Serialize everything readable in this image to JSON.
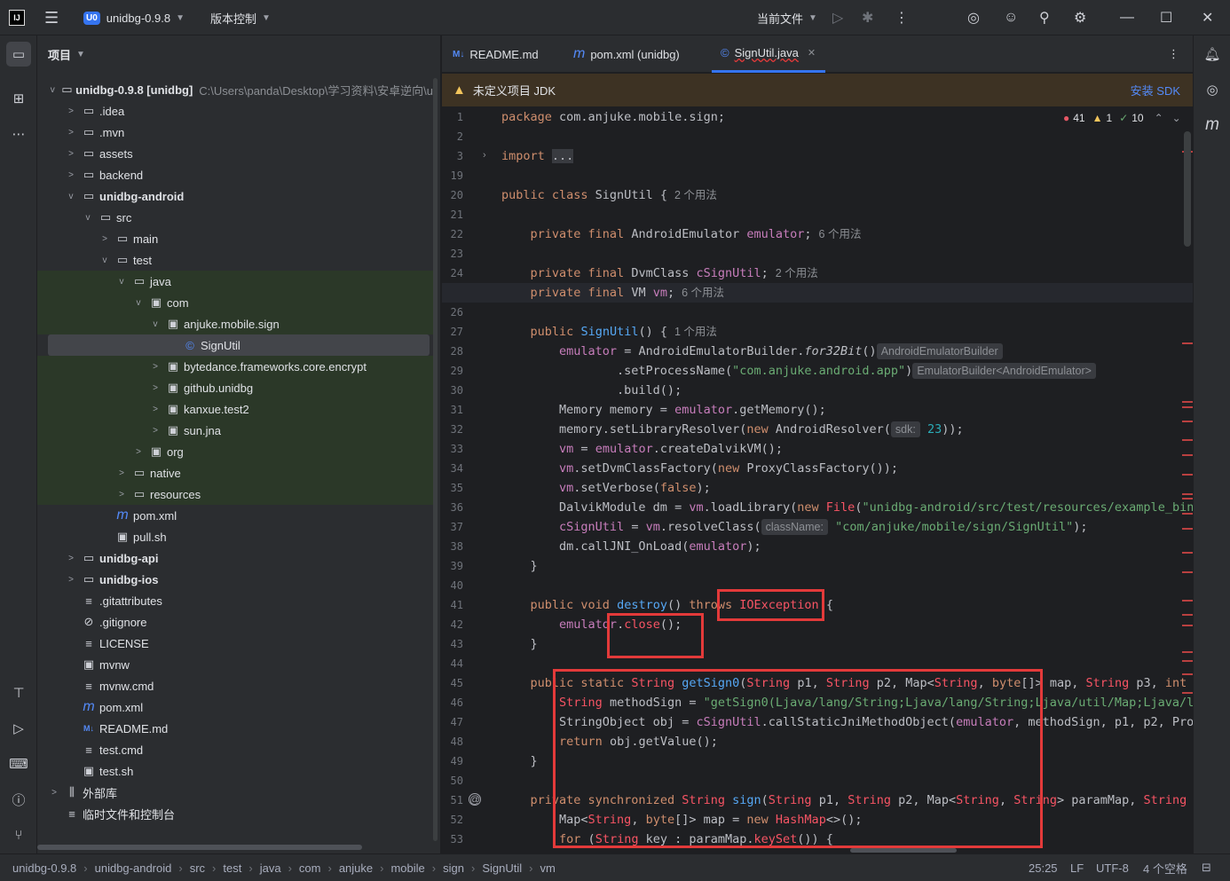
{
  "titlebar": {
    "logo": "IJ",
    "project_badge": "U0",
    "project": "unidbg-0.9.8",
    "vcs": "版本控制",
    "run_config": "当前文件"
  },
  "sidebar": {
    "panel_title": "项目"
  },
  "tree": [
    {
      "label": "unidbg-0.9.8 [unidbg]",
      "hint": "C:\\Users\\panda\\Desktop\\学习资料\\安卓逆向\\u",
      "indent": 0,
      "chev": "v",
      "icon": "▭",
      "bold": true
    },
    {
      "label": ".idea",
      "indent": 1,
      "chev": ">",
      "icon": "▭"
    },
    {
      "label": ".mvn",
      "indent": 1,
      "chev": ">",
      "icon": "▭"
    },
    {
      "label": "assets",
      "indent": 1,
      "chev": ">",
      "icon": "▭"
    },
    {
      "label": "backend",
      "indent": 1,
      "chev": ">",
      "icon": "▭"
    },
    {
      "label": "unidbg-android",
      "indent": 1,
      "chev": "v",
      "icon": "▭",
      "bold": true
    },
    {
      "label": "src",
      "indent": 2,
      "chev": "v",
      "icon": "▭"
    },
    {
      "label": "main",
      "indent": 3,
      "chev": ">",
      "icon": "▭"
    },
    {
      "label": "test",
      "indent": 3,
      "chev": "v",
      "icon": "▭"
    },
    {
      "label": "java",
      "indent": 4,
      "chev": "v",
      "icon": "▭",
      "green": true
    },
    {
      "label": "com",
      "indent": 5,
      "chev": "v",
      "icon": "▣",
      "green": true
    },
    {
      "label": "anjuke.mobile.sign",
      "indent": 6,
      "chev": "v",
      "icon": "▣",
      "green": true
    },
    {
      "label": "SignUtil",
      "indent": 7,
      "chev": "",
      "icon": "©",
      "sel": true
    },
    {
      "label": "bytedance.frameworks.core.encrypt",
      "indent": 6,
      "chev": ">",
      "icon": "▣",
      "green": true
    },
    {
      "label": "github.unidbg",
      "indent": 6,
      "chev": ">",
      "icon": "▣",
      "green": true
    },
    {
      "label": "kanxue.test2",
      "indent": 6,
      "chev": ">",
      "icon": "▣",
      "green": true
    },
    {
      "label": "sun.jna",
      "indent": 6,
      "chev": ">",
      "icon": "▣",
      "green": true
    },
    {
      "label": "org",
      "indent": 5,
      "chev": ">",
      "icon": "▣",
      "green": true
    },
    {
      "label": "native",
      "indent": 4,
      "chev": ">",
      "icon": "▭",
      "green": true
    },
    {
      "label": "resources",
      "indent": 4,
      "chev": ">",
      "icon": "▭",
      "green": true
    },
    {
      "label": "pom.xml",
      "indent": 3,
      "chev": "",
      "icon": "m"
    },
    {
      "label": "pull.sh",
      "indent": 3,
      "chev": "",
      "icon": "▣"
    },
    {
      "label": "unidbg-api",
      "indent": 1,
      "chev": ">",
      "icon": "▭",
      "bold": true
    },
    {
      "label": "unidbg-ios",
      "indent": 1,
      "chev": ">",
      "icon": "▭",
      "bold": true
    },
    {
      "label": ".gitattributes",
      "indent": 1,
      "chev": "",
      "icon": "≡"
    },
    {
      "label": ".gitignore",
      "indent": 1,
      "chev": "",
      "icon": "⊘"
    },
    {
      "label": "LICENSE",
      "indent": 1,
      "chev": "",
      "icon": "≡"
    },
    {
      "label": "mvnw",
      "indent": 1,
      "chev": "",
      "icon": "▣"
    },
    {
      "label": "mvnw.cmd",
      "indent": 1,
      "chev": "",
      "icon": "≡"
    },
    {
      "label": "pom.xml",
      "indent": 1,
      "chev": "",
      "icon": "m"
    },
    {
      "label": "README.md",
      "indent": 1,
      "chev": "",
      "icon": "M↓"
    },
    {
      "label": "test.cmd",
      "indent": 1,
      "chev": "",
      "icon": "≡"
    },
    {
      "label": "test.sh",
      "indent": 1,
      "chev": "",
      "icon": "▣"
    },
    {
      "label": "外部库",
      "indent": 0,
      "chev": ">",
      "icon": "⫼"
    },
    {
      "label": "临时文件和控制台",
      "indent": 0,
      "chev": "",
      "icon": "≡"
    }
  ],
  "tabs": [
    {
      "icon": "M↓",
      "label": "README.md",
      "active": false
    },
    {
      "icon": "m",
      "label": "pom.xml (unidbg)",
      "active": false
    },
    {
      "icon": "©",
      "label": "SignUtil.java",
      "active": true
    }
  ],
  "warning": {
    "text": "未定义项目 JDK",
    "action": "安装 SDK"
  },
  "inspections": {
    "errors": "41",
    "warnings": "1",
    "weak": "10"
  },
  "line_numbers": [
    "1",
    "2",
    "3",
    "19",
    "20",
    "21",
    "22",
    "23",
    "24",
    "25",
    "26",
    "27",
    "28",
    "29",
    "30",
    "31",
    "32",
    "33",
    "34",
    "35",
    "36",
    "37",
    "38",
    "39",
    "40",
    "41",
    "42",
    "43",
    "44",
    "45",
    "46",
    "47",
    "48",
    "49",
    "50",
    "51",
    "52",
    "53"
  ],
  "hints": {
    "u2": "2 个用法",
    "u6": "6 个用法",
    "u6b": "6 个用法",
    "u2b": "2 个用法",
    "u6c": "6 个用法",
    "u1": "1 个用法",
    "t1": "AndroidEmulatorBuilder",
    "t2": "EmulatorBuilder<AndroidEmulator>",
    "sdk": "sdk:",
    "cn": "className:",
    "u1b": "1 个"
  },
  "statusbar": {
    "crumbs": [
      "unidbg-0.9.8",
      "unidbg-android",
      "src",
      "test",
      "java",
      "com",
      "anjuke",
      "mobile",
      "sign",
      "SignUtil",
      "vm"
    ],
    "pos": "25:25",
    "le": "LF",
    "enc": "UTF-8",
    "indent": "4 个空格"
  }
}
